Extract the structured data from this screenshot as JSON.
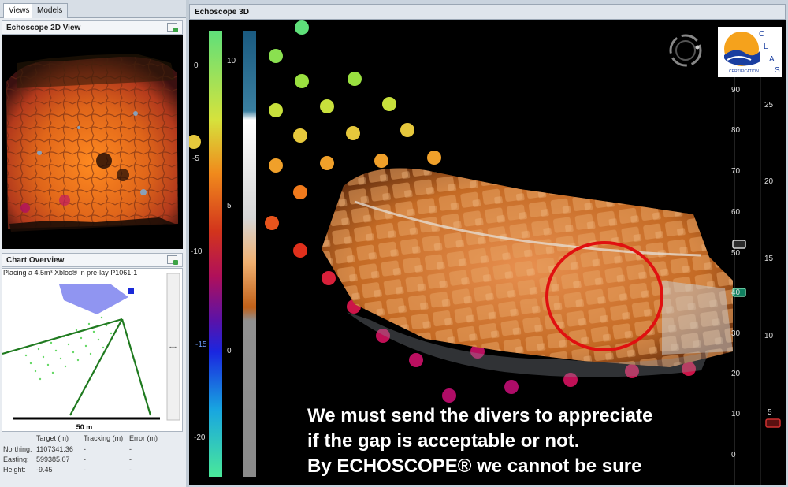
{
  "tabs": [
    {
      "label": "Views",
      "active": true
    },
    {
      "label": "Models",
      "active": false
    }
  ],
  "view2d": {
    "title": "Echoscope 2D View"
  },
  "chart_overview": {
    "title": "Chart Overview",
    "subtitle": "Placing a 4.5m³ Xbloc® in pre-lay P1061-1",
    "scale_label": "50 m",
    "side_marker": "---"
  },
  "position_table": {
    "headers": [
      "Target (m)",
      "Tracking (m)",
      "Error (m)"
    ],
    "rows": [
      {
        "label": "Northing:",
        "target": "1107341.36",
        "tracking": "-",
        "error": "-"
      },
      {
        "label": "Easting:",
        "target": "599385.07",
        "tracking": "-",
        "error": "-"
      },
      {
        "label": "Height:",
        "target": "-9.45",
        "tracking": "-",
        "error": "-"
      }
    ]
  },
  "view3d": {
    "title": "Echoscope 3D",
    "caption": [
      "We must send the divers to appreciate",
      "if the gap is acceptable or not.",
      "By ECHOSCOPE® we cannot be sure"
    ],
    "depth_scale_left": [
      "0",
      "-5",
      "-10",
      "-15",
      "-20"
    ],
    "depth_scale_mid": [
      "10",
      "5",
      "0"
    ],
    "range_scale_right_a": [
      "90",
      "80",
      "70",
      "60",
      "50",
      "40",
      "30",
      "20",
      "10",
      "0"
    ],
    "range_scale_right_b": [
      "25",
      "20",
      "15",
      "10",
      "5"
    ],
    "logo": {
      "letters": [
        "C",
        "L",
        "A",
        "S"
      ],
      "text": "CERTIFICATION"
    },
    "colors": {
      "highlight_circle": "#e01010",
      "rock_orange": "#d9731f",
      "background": "#000000"
    }
  }
}
